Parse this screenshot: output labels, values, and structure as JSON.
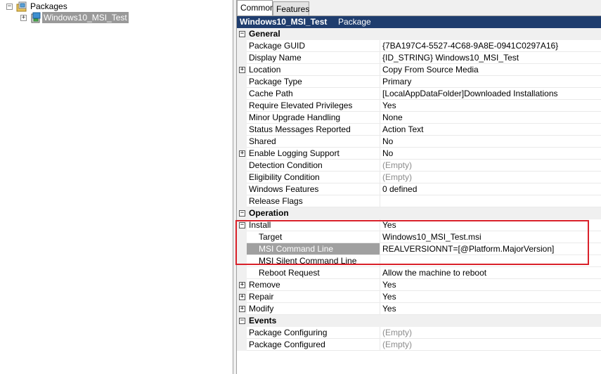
{
  "tree": {
    "root_label": "Packages",
    "root_expander": "−",
    "child_label": "Windows10_MSI_Test",
    "child_expander": "+"
  },
  "tabs": [
    {
      "label": "Common"
    },
    {
      "label": "Features"
    }
  ],
  "header": {
    "title": "Windows10_MSI_Test",
    "type": "Package"
  },
  "grid": {
    "general": {
      "label": "General",
      "rows": [
        {
          "name": "Package GUID",
          "value": "{7BA197C4-5527-4C68-9A8E-0941C0297A16}"
        },
        {
          "name": "Display Name",
          "value": "{ID_STRING} Windows10_MSI_Test"
        },
        {
          "name": "Location",
          "value": "Copy From Source Media"
        },
        {
          "name": "Package Type",
          "value": "Primary"
        },
        {
          "name": "Cache Path",
          "value": "[LocalAppDataFolder]Downloaded Installations"
        },
        {
          "name": "Require Elevated Privileges",
          "value": "Yes"
        },
        {
          "name": "Minor Upgrade Handling",
          "value": "None"
        },
        {
          "name": "Status Messages Reported",
          "value": "Action Text"
        },
        {
          "name": "Shared",
          "value": "No"
        },
        {
          "name": "Enable Logging Support",
          "value": "No"
        },
        {
          "name": "Detection Condition",
          "value": "(Empty)"
        },
        {
          "name": "Eligibility Condition",
          "value": "(Empty)"
        },
        {
          "name": "Windows Features",
          "value": "0 defined"
        },
        {
          "name": "Release Flags",
          "value": ""
        }
      ]
    },
    "operation": {
      "label": "Operation",
      "install": {
        "name": "Install",
        "value": "Yes"
      },
      "install_children": [
        {
          "name": "Target",
          "value": "Windows10_MSI_Test.msi"
        },
        {
          "name": "MSI Command Line",
          "value": "REALVERSIONNT=[@Platform.MajorVersion]"
        },
        {
          "name": "MSI Silent Command Line",
          "value": ""
        },
        {
          "name": "Reboot Request",
          "value": "Allow the machine to reboot"
        }
      ],
      "rows": [
        {
          "name": "Remove",
          "value": "Yes"
        },
        {
          "name": "Repair",
          "value": "Yes"
        },
        {
          "name": "Modify",
          "value": "Yes"
        }
      ]
    },
    "events": {
      "label": "Events",
      "rows": [
        {
          "name": "Package Configuring",
          "value": "(Empty)"
        },
        {
          "name": "Package Configured",
          "value": "(Empty)"
        }
      ]
    },
    "expand_glyph": "+",
    "collapse_glyph": "−"
  }
}
